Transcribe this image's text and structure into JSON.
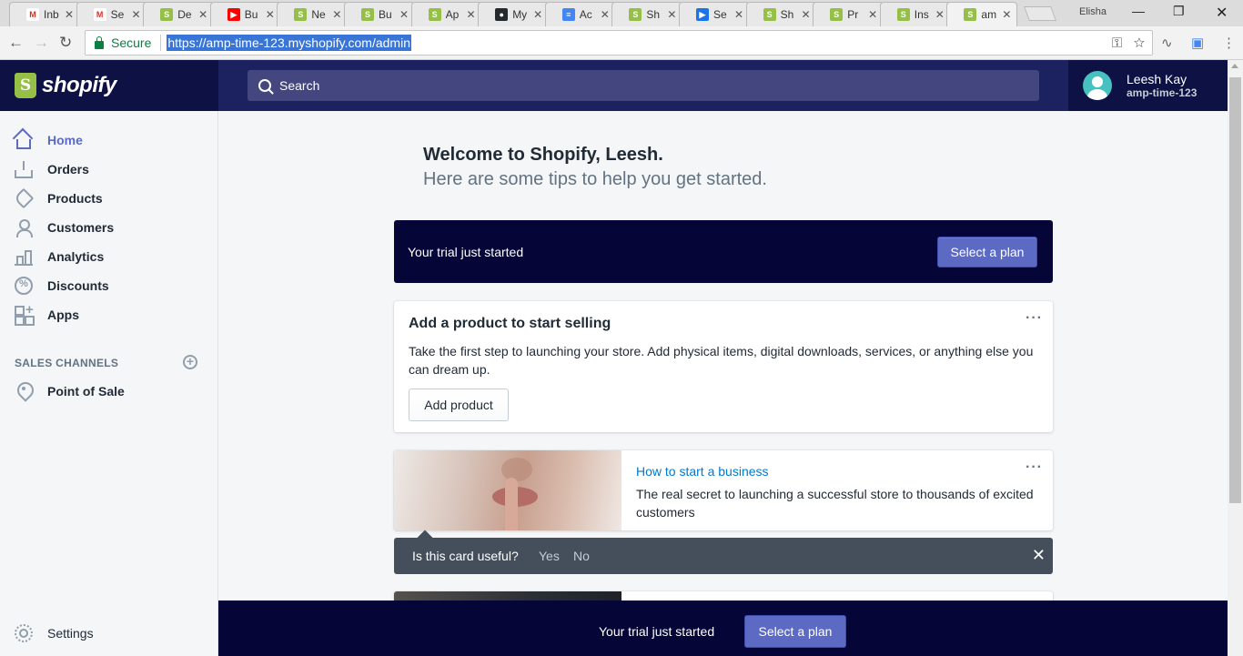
{
  "browser": {
    "tabs": [
      {
        "label": "Inb",
        "favicon": "gmail-icon",
        "color": "#ffffff",
        "glyph": "M",
        "glyphColor": "#d93025"
      },
      {
        "label": "Se",
        "favicon": "gmail-icon",
        "color": "#ffffff",
        "glyph": "M",
        "glyphColor": "#d93025"
      },
      {
        "label": "De",
        "favicon": "shopify-icon",
        "color": "#95bf47",
        "glyph": "S",
        "glyphColor": "#ffffff"
      },
      {
        "label": "Bu",
        "favicon": "youtube-icon",
        "color": "#ff0000",
        "glyph": "▶",
        "glyphColor": "#ffffff"
      },
      {
        "label": "Ne",
        "favicon": "shopify-icon",
        "color": "#95bf47",
        "glyph": "S",
        "glyphColor": "#ffffff"
      },
      {
        "label": "Bu",
        "favicon": "shopify-icon",
        "color": "#95bf47",
        "glyph": "S",
        "glyphColor": "#ffffff"
      },
      {
        "label": "Ap",
        "favicon": "shopify-icon",
        "color": "#95bf47",
        "glyph": "S",
        "glyphColor": "#ffffff"
      },
      {
        "label": "My",
        "favicon": "github-icon",
        "color": "#24292e",
        "glyph": "●",
        "glyphColor": "#ffffff"
      },
      {
        "label": "Ac",
        "favicon": "docs-icon",
        "color": "#4285f4",
        "glyph": "≡",
        "glyphColor": "#ffffff"
      },
      {
        "label": "Sh",
        "favicon": "shopify-icon",
        "color": "#95bf47",
        "glyph": "S",
        "glyphColor": "#ffffff"
      },
      {
        "label": "Se",
        "favicon": "video-icon",
        "color": "#1a73e8",
        "glyph": "▶",
        "glyphColor": "#ffffff"
      },
      {
        "label": "Sh",
        "favicon": "shopify-icon",
        "color": "#95bf47",
        "glyph": "S",
        "glyphColor": "#ffffff"
      },
      {
        "label": "Pr",
        "favicon": "shopify-icon",
        "color": "#95bf47",
        "glyph": "S",
        "glyphColor": "#ffffff"
      },
      {
        "label": "Ins",
        "favicon": "shopify-icon",
        "color": "#95bf47",
        "glyph": "S",
        "glyphColor": "#ffffff"
      },
      {
        "label": "am",
        "favicon": "shopify-icon",
        "color": "#95bf47",
        "glyph": "S",
        "glyphColor": "#ffffff",
        "active": true
      }
    ],
    "profile_name": "Elisha",
    "secure_label": "Secure",
    "url": "https://amp-time-123.myshopify.com/admin"
  },
  "header": {
    "brand": "shopify",
    "search_placeholder": "Search",
    "user_name": "Leesh Kay",
    "store_name": "amp-time-123"
  },
  "sidebar": {
    "items": [
      {
        "label": "Home",
        "icon": "home-icon",
        "active": true
      },
      {
        "label": "Orders",
        "icon": "orders-icon"
      },
      {
        "label": "Products",
        "icon": "tag-icon"
      },
      {
        "label": "Customers",
        "icon": "user-icon"
      },
      {
        "label": "Analytics",
        "icon": "analytics-icon"
      },
      {
        "label": "Discounts",
        "icon": "discount-icon"
      },
      {
        "label": "Apps",
        "icon": "apps-icon"
      }
    ],
    "sales_channels_heading": "SALES CHANNELS",
    "channels": [
      {
        "label": "Point of Sale",
        "icon": "location-pin-icon"
      }
    ],
    "settings_label": "Settings"
  },
  "main": {
    "welcome": "Welcome to Shopify, Leesh.",
    "tips": "Here are some tips to help you get started.",
    "trial_banner": {
      "text": "Your trial just started",
      "button": "Select a plan"
    },
    "add_product_card": {
      "title": "Add a product to start selling",
      "body": "Take the first step to launching your store. Add physical items, digital downloads, services, or anything else you can dream up.",
      "button": "Add product"
    },
    "article_card": {
      "link": "How to start a business",
      "body": "The real secret to launching a successful store to thousands of excited customers"
    },
    "feedback": {
      "question": "Is this card useful?",
      "yes": "Yes",
      "no": "No"
    },
    "bottom_bar": {
      "text": "Your trial just started",
      "button": "Select a plan"
    }
  },
  "colors": {
    "accent": "#5c6ac4",
    "topbar": "#1c2260",
    "banner": "#050537",
    "link": "#007ace"
  }
}
